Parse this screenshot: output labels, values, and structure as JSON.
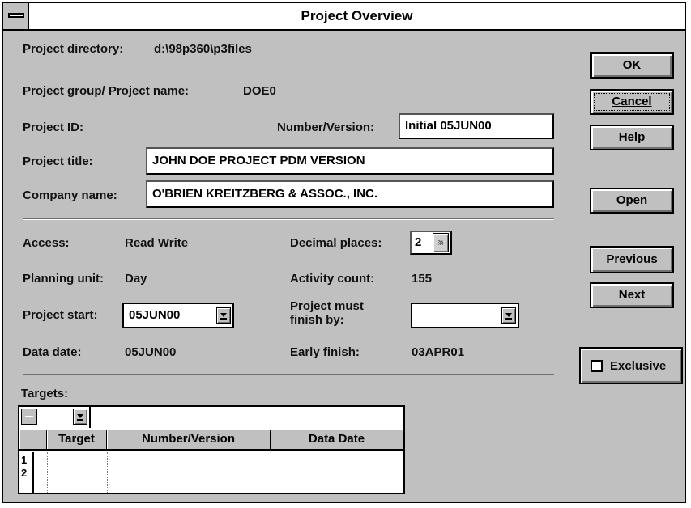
{
  "window": {
    "title": "Project Overview"
  },
  "info": {
    "project_directory_label": "Project directory:",
    "project_directory": "d:\\98p360\\p3files",
    "group_name_label": "Project group/ Project name:",
    "group_name": "DOE0",
    "project_id_label": "Project ID:",
    "number_version_label": "Number/Version:",
    "number_version": "Initial 05JUN00",
    "project_title_label": "Project title:",
    "project_title": "JOHN DOE PROJECT PDM VERSION",
    "company_name_label": "Company name:",
    "company_name": "O'BRIEN KREITZBERG & ASSOC., INC."
  },
  "details": {
    "access_label": "Access:",
    "access": "Read Write",
    "decimal_label": "Decimal places:",
    "decimal_value": "2",
    "planning_unit_label": "Planning unit:",
    "planning_unit": "Day",
    "activity_count_label": "Activity count:",
    "activity_count": "155",
    "project_start_label": "Project start:",
    "project_start": "05JUN00",
    "must_finish_label_1": "Project must",
    "must_finish_label_2": "finish by:",
    "must_finish_value": "",
    "data_date_label": "Data date:",
    "data_date": "05JUN00",
    "early_finish_label": "Early finish:",
    "early_finish": "03APR01"
  },
  "targets": {
    "label": "Targets:",
    "columns": [
      "Target",
      "Number/Version",
      "Data Date"
    ],
    "rows": [
      "1",
      "2"
    ]
  },
  "buttons": {
    "ok": "OK",
    "cancel": "Cancel",
    "help": "Help",
    "open": "Open",
    "previous": "Previous",
    "next": "Next",
    "exclusive": "Exclusive"
  },
  "colors": {
    "face": "#c0c0c0",
    "field": "#ffffff",
    "border": "#000000"
  },
  "icons": {
    "system_menu": "system-menu-icon",
    "dropdown": "dropdown-arrow-icon",
    "spinner": "spinner-icon"
  }
}
